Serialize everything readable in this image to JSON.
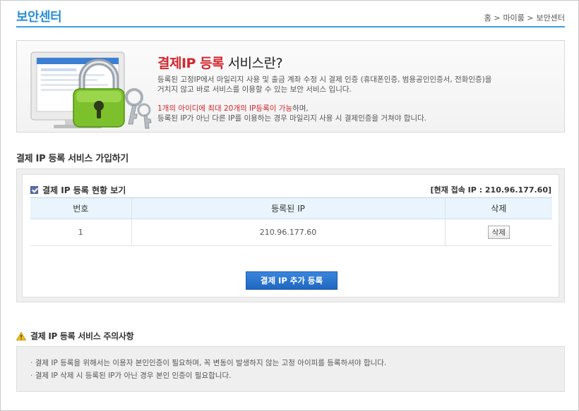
{
  "header": {
    "title": "보안센터",
    "breadcrumb": [
      "홈 >",
      "마이룸 >",
      "보안센터"
    ]
  },
  "intro": {
    "title_red": "결제IP 등록",
    "title_rest": " 서비스란?",
    "desc_line1": "등록된 고정IP에서 마일리지 사용 및 출금 계좌 수정 시 결제 인증 (휴대폰인증, 범용공인인증서, 전화인증)을",
    "desc_line2": "거치지 않고 바로 서비스를 이용할 수 있는 보안 서비스 입니다.",
    "note_red": "1개의 아이디에 최대 20개의 IP등록이 가능",
    "note_rest": "하며,",
    "note_line2": "등록된 IP가 아닌 다른 IP를 이용하는 경우 마일리지 사용 시 결제인증을 거쳐야 합니다."
  },
  "signup": {
    "section_title": "결제 IP 등록 서비스 가입하기",
    "status_label": "결제 IP 등록 현황 보기",
    "current_ip": "[현재 접속 IP : 210.96.177.60]",
    "columns": [
      "번호",
      "등록된 IP",
      "삭제"
    ],
    "rows": [
      {
        "no": "1",
        "ip": "210.96.177.60",
        "delete_label": "삭제"
      }
    ],
    "add_button": "결제 IP 추가 등록"
  },
  "notice": {
    "section_title": "결제 IP 등록 서비스 주의사항",
    "items": [
      "결제 IP 등록을 위해서는 이용자 본인인증이 필요하며, 꼭 변동이 발생하지 않는 고정 아이피를 등록하셔야 합니다.",
      "결제 IP 삭제 시 등록된 IP가 아닌 경우 본인 인증이 필요합니다."
    ]
  },
  "colors": {
    "accent": "#2b8fd6",
    "highlight_red": "#d1282e",
    "button_blue": "#2573cf"
  }
}
